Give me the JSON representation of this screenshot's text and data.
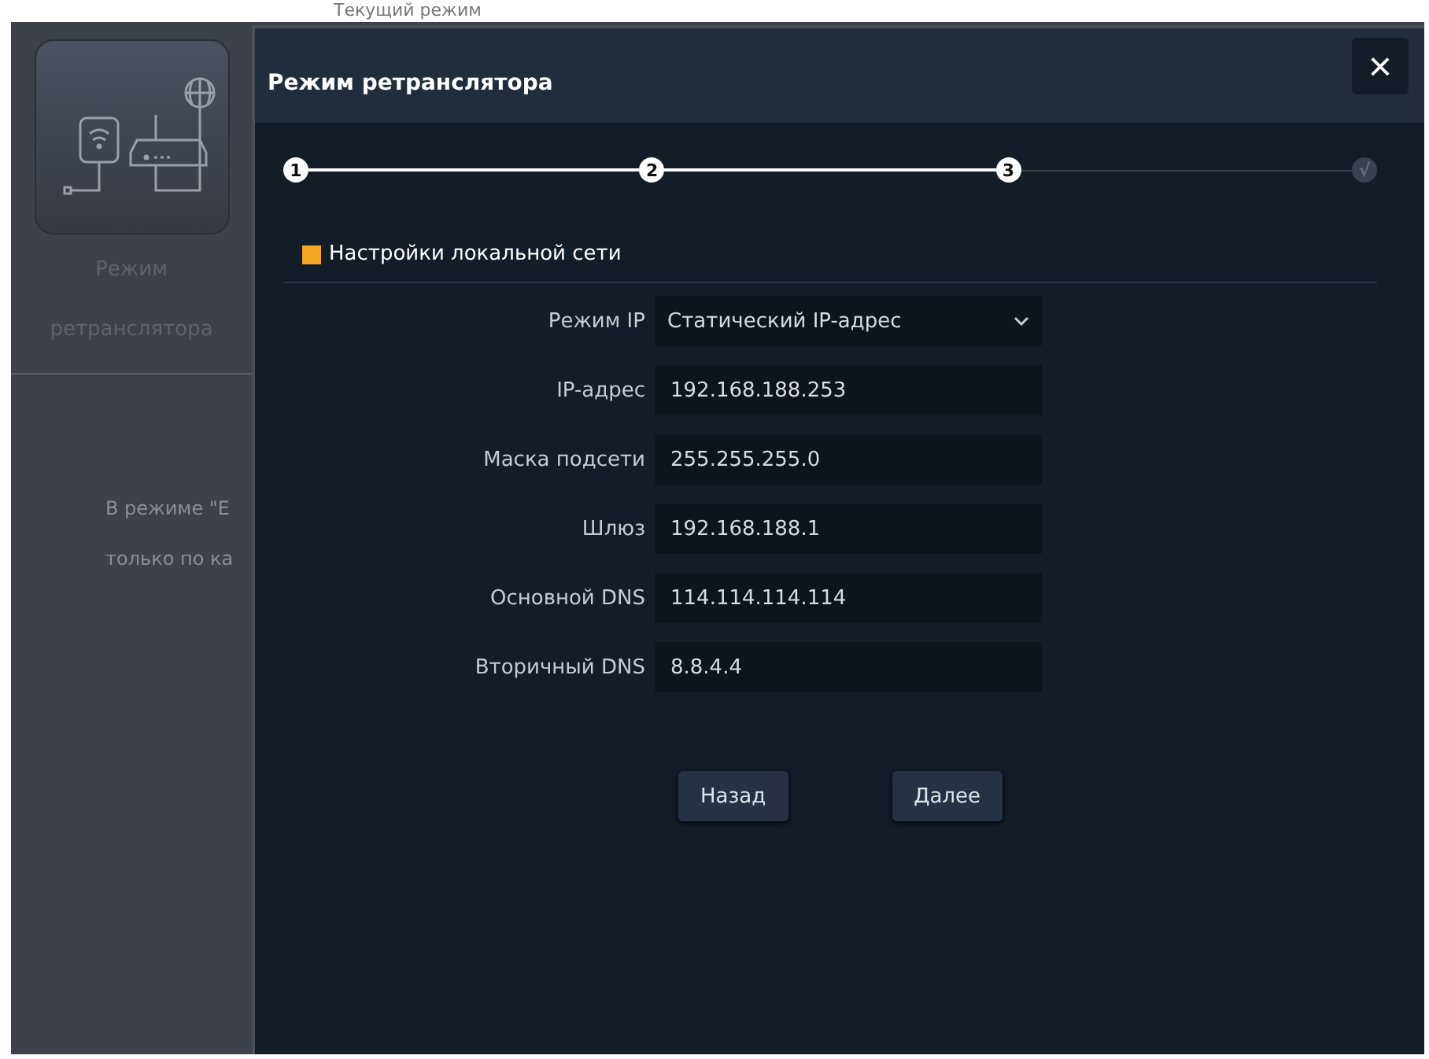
{
  "background": {
    "top_label": "Текущий режим",
    "mode_card": {
      "label_lines": [
        "Режим",
        "ретранслятора"
      ]
    },
    "description_lines": [
      "В режиме \"Е",
      "только по ка"
    ]
  },
  "dialog": {
    "title": "Режим ретранслятора",
    "close": "×",
    "steps": [
      {
        "label": "1",
        "reached": true
      },
      {
        "label": "2",
        "reached": true
      },
      {
        "label": "3",
        "reached": true
      },
      {
        "label": "√",
        "reached": false
      }
    ],
    "section_title": "Настройки локальной сети",
    "fields": [
      {
        "kind": "select",
        "label": "Режим IP",
        "value": "Статический IP-адрес"
      },
      {
        "kind": "text",
        "label": "IP-адрес",
        "value": "192.168.188.253"
      },
      {
        "kind": "text",
        "label": "Маска подсети",
        "value": "255.255.255.0"
      },
      {
        "kind": "text",
        "label": "Шлюз",
        "value": "192.168.188.1"
      },
      {
        "kind": "text",
        "label": "Основной DNS",
        "value": "114.114.114.114"
      },
      {
        "kind": "text",
        "label": "Вторичный DNS",
        "value": "8.8.4.4"
      }
    ],
    "buttons": [
      "Назад",
      "Далее"
    ]
  }
}
